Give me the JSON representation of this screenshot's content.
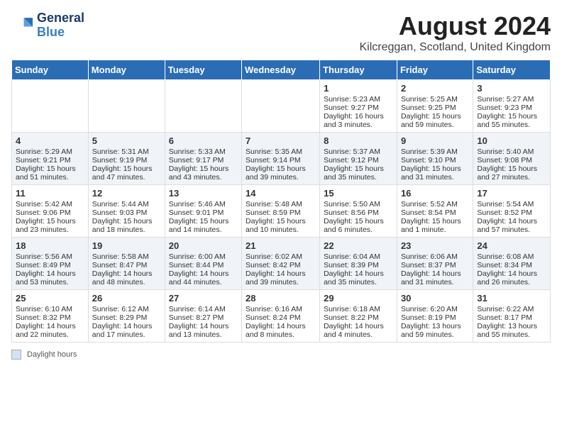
{
  "logo": {
    "line1": "General",
    "line2": "Blue"
  },
  "title": "August 2024",
  "subtitle": "Kilcreggan, Scotland, United Kingdom",
  "days_header": [
    "Sunday",
    "Monday",
    "Tuesday",
    "Wednesday",
    "Thursday",
    "Friday",
    "Saturday"
  ],
  "weeks": [
    [
      {
        "num": "",
        "sunrise": "",
        "sunset": "",
        "daylight": ""
      },
      {
        "num": "",
        "sunrise": "",
        "sunset": "",
        "daylight": ""
      },
      {
        "num": "",
        "sunrise": "",
        "sunset": "",
        "daylight": ""
      },
      {
        "num": "",
        "sunrise": "",
        "sunset": "",
        "daylight": ""
      },
      {
        "num": "1",
        "sunrise": "Sunrise: 5:23 AM",
        "sunset": "Sunset: 9:27 PM",
        "daylight": "Daylight: 16 hours and 3 minutes."
      },
      {
        "num": "2",
        "sunrise": "Sunrise: 5:25 AM",
        "sunset": "Sunset: 9:25 PM",
        "daylight": "Daylight: 15 hours and 59 minutes."
      },
      {
        "num": "3",
        "sunrise": "Sunrise: 5:27 AM",
        "sunset": "Sunset: 9:23 PM",
        "daylight": "Daylight: 15 hours and 55 minutes."
      }
    ],
    [
      {
        "num": "4",
        "sunrise": "Sunrise: 5:29 AM",
        "sunset": "Sunset: 9:21 PM",
        "daylight": "Daylight: 15 hours and 51 minutes."
      },
      {
        "num": "5",
        "sunrise": "Sunrise: 5:31 AM",
        "sunset": "Sunset: 9:19 PM",
        "daylight": "Daylight: 15 hours and 47 minutes."
      },
      {
        "num": "6",
        "sunrise": "Sunrise: 5:33 AM",
        "sunset": "Sunset: 9:17 PM",
        "daylight": "Daylight: 15 hours and 43 minutes."
      },
      {
        "num": "7",
        "sunrise": "Sunrise: 5:35 AM",
        "sunset": "Sunset: 9:14 PM",
        "daylight": "Daylight: 15 hours and 39 minutes."
      },
      {
        "num": "8",
        "sunrise": "Sunrise: 5:37 AM",
        "sunset": "Sunset: 9:12 PM",
        "daylight": "Daylight: 15 hours and 35 minutes."
      },
      {
        "num": "9",
        "sunrise": "Sunrise: 5:39 AM",
        "sunset": "Sunset: 9:10 PM",
        "daylight": "Daylight: 15 hours and 31 minutes."
      },
      {
        "num": "10",
        "sunrise": "Sunrise: 5:40 AM",
        "sunset": "Sunset: 9:08 PM",
        "daylight": "Daylight: 15 hours and 27 minutes."
      }
    ],
    [
      {
        "num": "11",
        "sunrise": "Sunrise: 5:42 AM",
        "sunset": "Sunset: 9:06 PM",
        "daylight": "Daylight: 15 hours and 23 minutes."
      },
      {
        "num": "12",
        "sunrise": "Sunrise: 5:44 AM",
        "sunset": "Sunset: 9:03 PM",
        "daylight": "Daylight: 15 hours and 18 minutes."
      },
      {
        "num": "13",
        "sunrise": "Sunrise: 5:46 AM",
        "sunset": "Sunset: 9:01 PM",
        "daylight": "Daylight: 15 hours and 14 minutes."
      },
      {
        "num": "14",
        "sunrise": "Sunrise: 5:48 AM",
        "sunset": "Sunset: 8:59 PM",
        "daylight": "Daylight: 15 hours and 10 minutes."
      },
      {
        "num": "15",
        "sunrise": "Sunrise: 5:50 AM",
        "sunset": "Sunset: 8:56 PM",
        "daylight": "Daylight: 15 hours and 6 minutes."
      },
      {
        "num": "16",
        "sunrise": "Sunrise: 5:52 AM",
        "sunset": "Sunset: 8:54 PM",
        "daylight": "Daylight: 15 hours and 1 minute."
      },
      {
        "num": "17",
        "sunrise": "Sunrise: 5:54 AM",
        "sunset": "Sunset: 8:52 PM",
        "daylight": "Daylight: 14 hours and 57 minutes."
      }
    ],
    [
      {
        "num": "18",
        "sunrise": "Sunrise: 5:56 AM",
        "sunset": "Sunset: 8:49 PM",
        "daylight": "Daylight: 14 hours and 53 minutes."
      },
      {
        "num": "19",
        "sunrise": "Sunrise: 5:58 AM",
        "sunset": "Sunset: 8:47 PM",
        "daylight": "Daylight: 14 hours and 48 minutes."
      },
      {
        "num": "20",
        "sunrise": "Sunrise: 6:00 AM",
        "sunset": "Sunset: 8:44 PM",
        "daylight": "Daylight: 14 hours and 44 minutes."
      },
      {
        "num": "21",
        "sunrise": "Sunrise: 6:02 AM",
        "sunset": "Sunset: 8:42 PM",
        "daylight": "Daylight: 14 hours and 39 minutes."
      },
      {
        "num": "22",
        "sunrise": "Sunrise: 6:04 AM",
        "sunset": "Sunset: 8:39 PM",
        "daylight": "Daylight: 14 hours and 35 minutes."
      },
      {
        "num": "23",
        "sunrise": "Sunrise: 6:06 AM",
        "sunset": "Sunset: 8:37 PM",
        "daylight": "Daylight: 14 hours and 31 minutes."
      },
      {
        "num": "24",
        "sunrise": "Sunrise: 6:08 AM",
        "sunset": "Sunset: 8:34 PM",
        "daylight": "Daylight: 14 hours and 26 minutes."
      }
    ],
    [
      {
        "num": "25",
        "sunrise": "Sunrise: 6:10 AM",
        "sunset": "Sunset: 8:32 PM",
        "daylight": "Daylight: 14 hours and 22 minutes."
      },
      {
        "num": "26",
        "sunrise": "Sunrise: 6:12 AM",
        "sunset": "Sunset: 8:29 PM",
        "daylight": "Daylight: 14 hours and 17 minutes."
      },
      {
        "num": "27",
        "sunrise": "Sunrise: 6:14 AM",
        "sunset": "Sunset: 8:27 PM",
        "daylight": "Daylight: 14 hours and 13 minutes."
      },
      {
        "num": "28",
        "sunrise": "Sunrise: 6:16 AM",
        "sunset": "Sunset: 8:24 PM",
        "daylight": "Daylight: 14 hours and 8 minutes."
      },
      {
        "num": "29",
        "sunrise": "Sunrise: 6:18 AM",
        "sunset": "Sunset: 8:22 PM",
        "daylight": "Daylight: 14 hours and 4 minutes."
      },
      {
        "num": "30",
        "sunrise": "Sunrise: 6:20 AM",
        "sunset": "Sunset: 8:19 PM",
        "daylight": "Daylight: 13 hours and 59 minutes."
      },
      {
        "num": "31",
        "sunrise": "Sunrise: 6:22 AM",
        "sunset": "Sunset: 8:17 PM",
        "daylight": "Daylight: 13 hours and 55 minutes."
      }
    ]
  ],
  "footer": {
    "legend_label": "Daylight hours"
  }
}
